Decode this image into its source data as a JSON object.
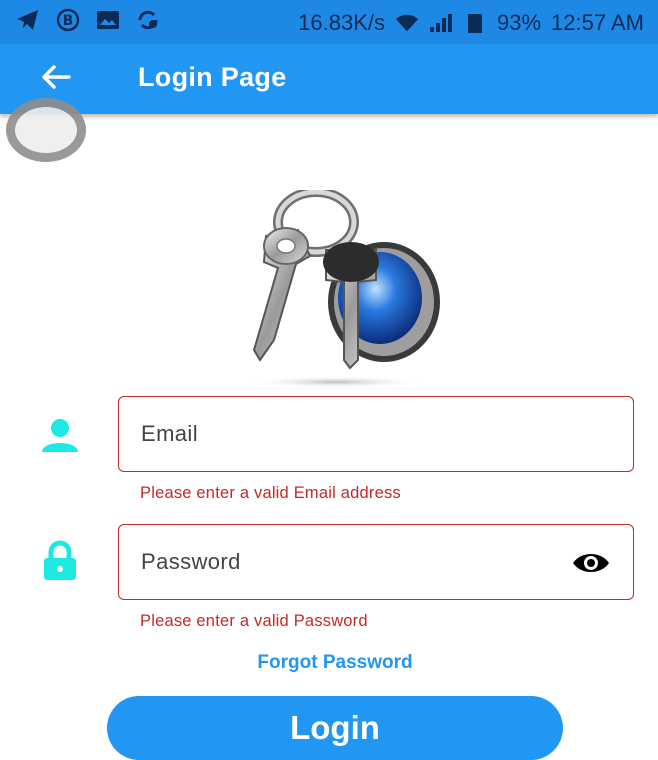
{
  "status_bar": {
    "speed": "16.83K/s",
    "battery": "93%",
    "time": "12:57 AM"
  },
  "app_bar": {
    "title": "Login Page"
  },
  "form": {
    "email": {
      "placeholder": "Email",
      "error": "Please enter a valid Email address"
    },
    "password": {
      "placeholder": "Password",
      "error": "Please enter a valid Password"
    },
    "forgot_label": "Forgot Password",
    "login_label": "Login"
  },
  "colors": {
    "primary": "#2196f3",
    "status_bar": "#1e88e5",
    "error": "#c62828",
    "accent_icon": "#1de9e3"
  },
  "icons": [
    "telegram-icon",
    "b-icon",
    "image-icon",
    "sync-icon",
    "wifi-icon",
    "signal-icon",
    "battery-icon",
    "back-arrow-icon",
    "person-icon",
    "lock-icon",
    "eye-icon"
  ]
}
